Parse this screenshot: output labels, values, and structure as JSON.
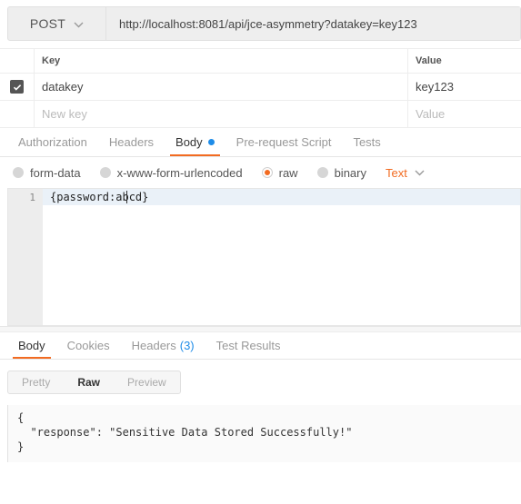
{
  "request": {
    "method": "POST",
    "url": "http://localhost:8081/api/jce-asymmetry?datakey=key123",
    "params": {
      "columns": {
        "key": "Key",
        "value": "Value"
      },
      "rows": [
        {
          "checked": true,
          "key": "datakey",
          "value": "key123"
        },
        {
          "checked": false,
          "key_placeholder": "New key",
          "value_placeholder": "Value"
        }
      ]
    },
    "tabs": [
      {
        "label": "Authorization",
        "active": false,
        "dot": false
      },
      {
        "label": "Headers",
        "active": false,
        "dot": false
      },
      {
        "label": "Body",
        "active": true,
        "dot": true
      },
      {
        "label": "Pre-request Script",
        "active": false,
        "dot": false
      },
      {
        "label": "Tests",
        "active": false,
        "dot": false
      }
    ],
    "body_types": [
      {
        "label": "form-data",
        "selected": false
      },
      {
        "label": "x-www-form-urlencoded",
        "selected": false
      },
      {
        "label": "raw",
        "selected": true
      },
      {
        "label": "binary",
        "selected": false
      }
    ],
    "format": "Text",
    "editor": {
      "line_number": "1",
      "content": "{password:abcd}"
    }
  },
  "response": {
    "tabs": [
      {
        "label": "Body",
        "count": "",
        "active": true
      },
      {
        "label": "Cookies",
        "count": "",
        "active": false
      },
      {
        "label": "Headers",
        "count": "(3)",
        "active": false
      },
      {
        "label": "Test Results",
        "count": "",
        "active": false
      }
    ],
    "views": [
      {
        "label": "Pretty",
        "active": false
      },
      {
        "label": "Raw",
        "active": true
      },
      {
        "label": "Preview",
        "active": false
      }
    ],
    "body": "{\n  \"response\": \"Sensitive Data Stored Successfully!\"\n}"
  },
  "colors": {
    "accent": "#f26b21",
    "info": "#1e8ce8",
    "text": "#333333",
    "muted": "#999999"
  }
}
